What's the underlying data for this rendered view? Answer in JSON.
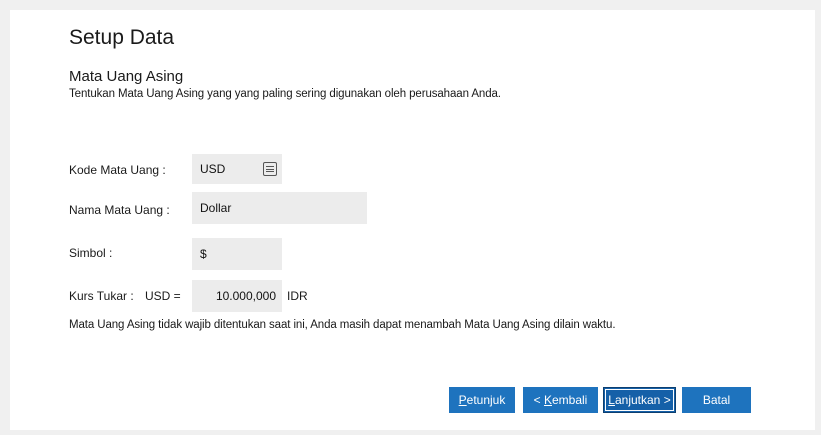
{
  "header": {
    "title": "Setup Data",
    "subtitle": "Mata Uang Asing",
    "description": "Tentukan Mata Uang Asing yang yang paling sering digunakan oleh perusahaan Anda."
  },
  "form": {
    "kode_label": "Kode Mata Uang :",
    "kode_value": "USD",
    "nama_label": "Nama Mata Uang :",
    "nama_value": "Dollar",
    "simbol_label": "Simbol :",
    "simbol_value": "$",
    "kurs_label": "Kurs Tukar :",
    "kurs_base": "USD =",
    "kurs_value": "10.000,000",
    "kurs_unit": "IDR"
  },
  "note": "Mata Uang Asing tidak wajib ditentukan saat ini, Anda masih dapat menambah Mata Uang Asing dilain waktu.",
  "buttons": {
    "petunjuk_key": "P",
    "petunjuk_rest": "etunjuk",
    "kembali_prefix": "< ",
    "kembali_key": "K",
    "kembali_rest": "embali",
    "lanjutkan_key": "L",
    "lanjutkan_rest": "anjutkan >",
    "batal": "Batal"
  },
  "icons": {
    "lookup": "list-icon"
  },
  "colors": {
    "button": "#1e73be",
    "field": "#ececec",
    "background": "#f0f0f0"
  }
}
